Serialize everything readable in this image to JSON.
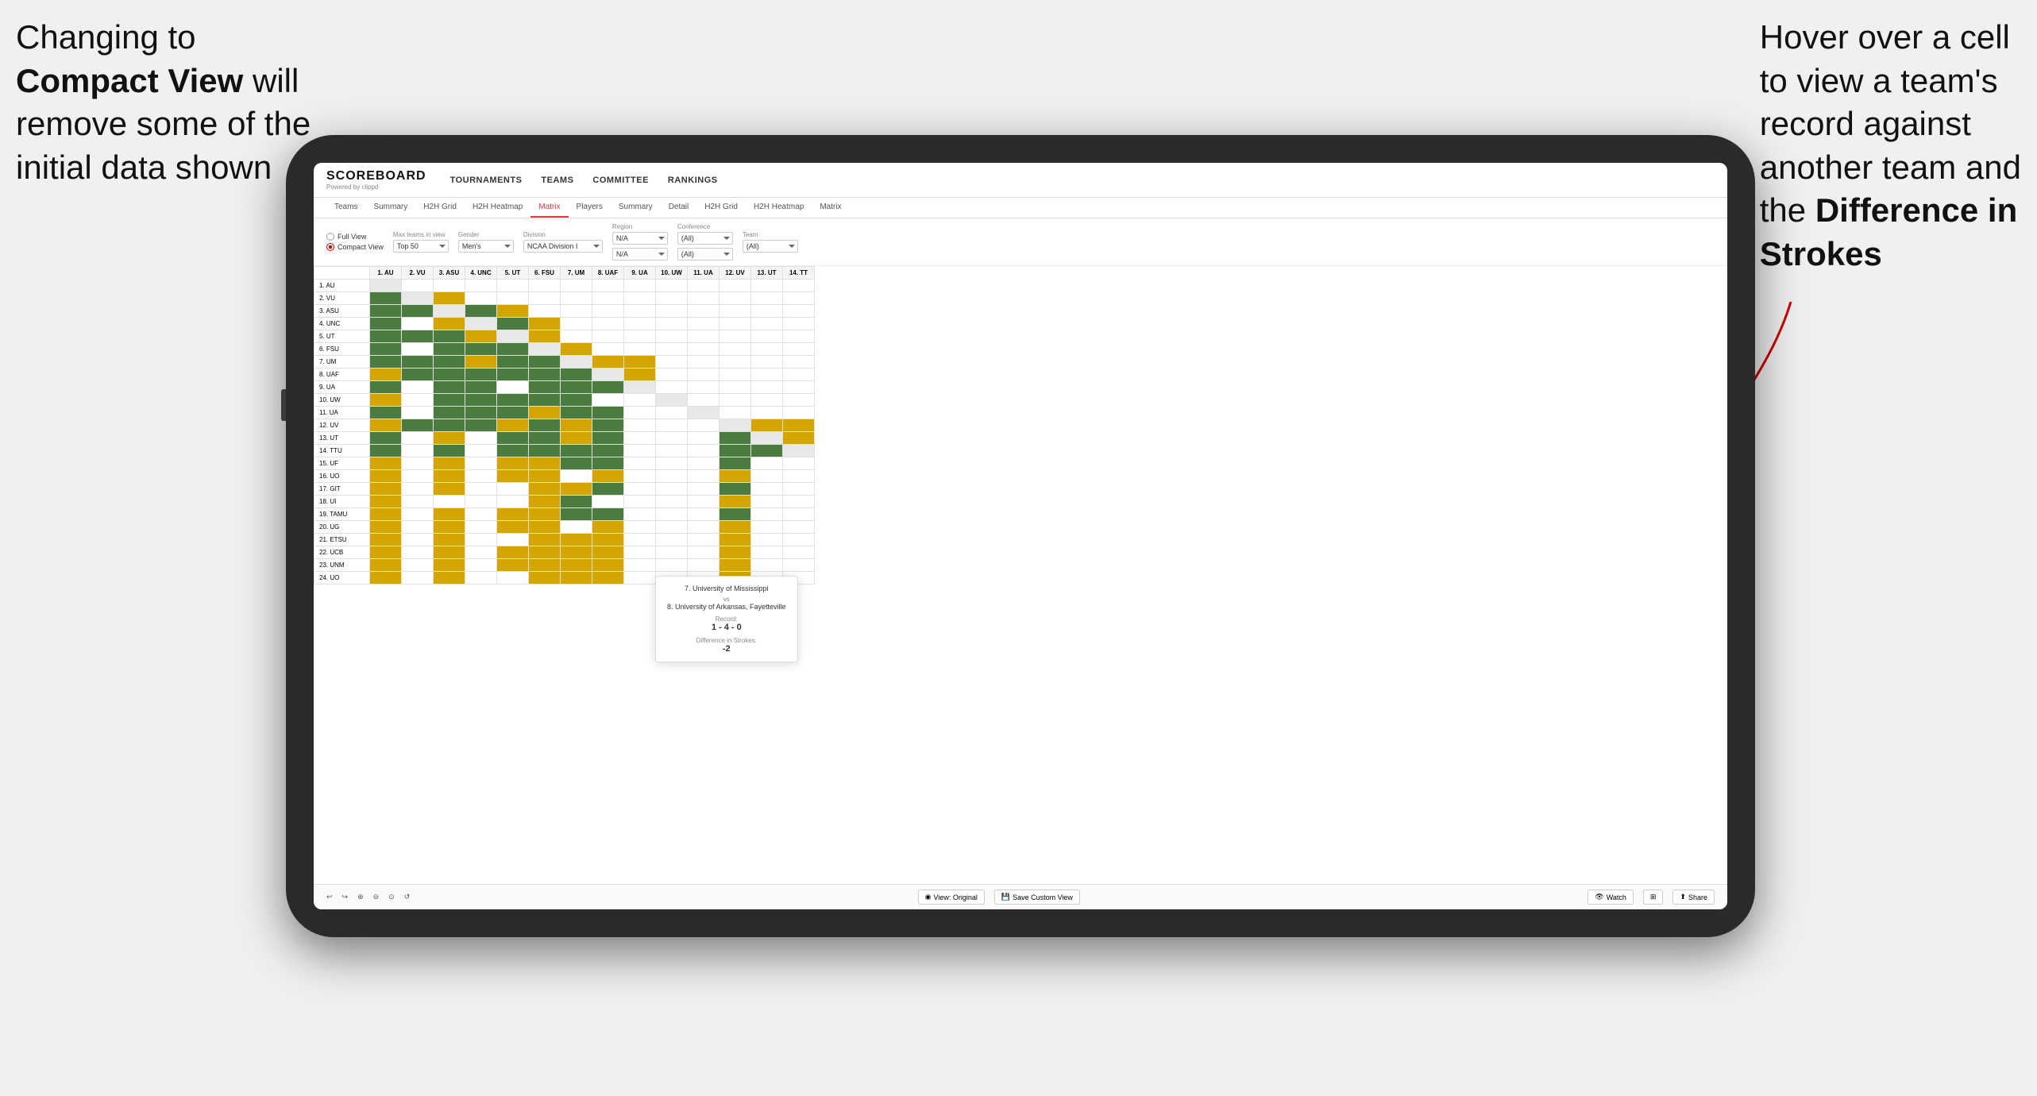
{
  "annotation_left": {
    "line1": "Changing to",
    "line2_bold": "Compact View",
    "line2_rest": " will",
    "line3": "remove some of the",
    "line4": "initial data shown"
  },
  "annotation_right": {
    "line1": "Hover over a cell",
    "line2": "to view a team's",
    "line3": "record against",
    "line4": "another team and",
    "line5_pre": "the ",
    "line5_bold": "Difference in",
    "line6_bold": "Strokes"
  },
  "app": {
    "logo": "SCOREBOARD",
    "logo_sub": "Powered by clippd",
    "nav": [
      "TOURNAMENTS",
      "TEAMS",
      "COMMITTEE",
      "RANKINGS"
    ],
    "sub_nav": [
      "Teams",
      "Summary",
      "H2H Grid",
      "H2H Heatmap",
      "Matrix",
      "Players",
      "Summary",
      "Detail",
      "H2H Grid",
      "H2H Heatmap",
      "Matrix"
    ],
    "active_sub": "Matrix",
    "filters": {
      "view_options": [
        "Full View",
        "Compact View"
      ],
      "selected_view": "Compact View",
      "max_teams_label": "Max teams in view",
      "max_teams_value": "Top 50",
      "gender_label": "Gender",
      "gender_value": "Men's",
      "division_label": "Division",
      "division_value": "NCAA Division I",
      "region_label": "Region",
      "region_value1": "N/A",
      "region_value2": "N/A",
      "conference_label": "Conference",
      "conference_value1": "(All)",
      "conference_value2": "(All)",
      "team_label": "Team",
      "team_value": "(All)"
    },
    "column_headers": [
      "1. AU",
      "2. VU",
      "3. ASU",
      "4. UNC",
      "5. UT",
      "6. FSU",
      "7. UM",
      "8. UAF",
      "9. UA",
      "10. UW",
      "11. UA",
      "12. UV",
      "13. UT",
      "14. TT"
    ],
    "row_headers": [
      "1. AU",
      "2. VU",
      "3. ASU",
      "4. UNC",
      "5. UT",
      "6. FSU",
      "7. UM",
      "8. UAF",
      "9. UA",
      "10. UW",
      "11. UA",
      "12. UV",
      "13. UT",
      "14. TTU",
      "15. UF",
      "16. UO",
      "17. GIT",
      "18. UI",
      "19. TAMU",
      "20. UG",
      "21. ETSU",
      "22. UCB",
      "23. UNM",
      "24. UO"
    ],
    "tooltip": {
      "team1": "7. University of Mississippi",
      "vs": "vs",
      "team2": "8. University of Arkansas, Fayetteville",
      "record_label": "Record:",
      "record": "1 - 4 - 0",
      "diff_label": "Difference in Strokes:",
      "diff": "-2"
    },
    "toolbar": {
      "undo": "↩",
      "redo": "↪",
      "icon1": "⊕",
      "icon2": "⊖",
      "icon3": "↺",
      "view_original": "View: Original",
      "save_custom": "Save Custom View",
      "watch": "Watch",
      "share": "Share"
    }
  }
}
